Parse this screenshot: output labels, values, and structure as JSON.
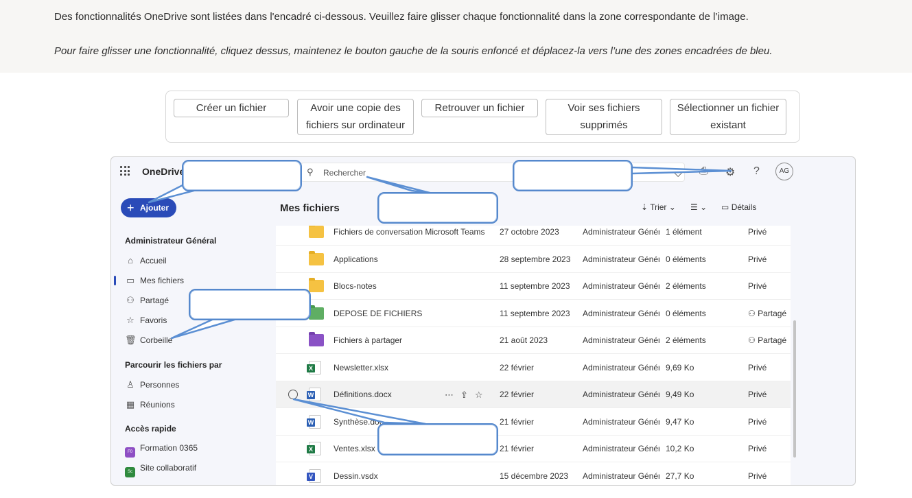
{
  "instructions": {
    "line1": "Des fonctionnalités OneDrive sont listées dans l'encadré ci-dessous. Veuillez faire glisser chaque fonctionnalité dans la zone correspondante de l’image.",
    "line2": "Pour faire glisser une fonctionnalité, cliquez dessus, maintenez le bouton gauche de la souris enfoncé et déplacez-la vers l’une des zones encadrées de bleu."
  },
  "chips": [
    {
      "line1": "Créer un fichier",
      "line2": ""
    },
    {
      "line1": "Avoir une copie des",
      "line2": "fichiers sur ordinateur"
    },
    {
      "line1": "Retrouver un fichier",
      "line2": ""
    },
    {
      "line1": "Voir ses fichiers",
      "line2": "supprimés"
    },
    {
      "line1": "Sélectionner un fichier",
      "line2": "existant"
    }
  ],
  "app": {
    "brand": "OneDrive",
    "search_placeholder": "Rechercher",
    "avatar": "AG",
    "add_label": "Ajouter",
    "page_title": "Mes fichiers",
    "sort_label": "Trier",
    "details_label": "Détails"
  },
  "sidebar": {
    "user": "Administrateur Général",
    "items": [
      "Accueil",
      "Mes fichiers",
      "Partagé",
      "Favoris",
      "Corbeille"
    ],
    "browse_title": "Parcourir les fichiers par",
    "browse_items": [
      "Personnes",
      "Réunions"
    ],
    "quick_title": "Accès rapide",
    "quick_items": [
      {
        "label": "Formation 0365",
        "badge": "F0",
        "color": "#8e4fc4"
      },
      {
        "label": "Site collaboratif",
        "badge": "Sc",
        "color": "#2f8a3e"
      }
    ]
  },
  "files": [
    {
      "name": "Fichiers de conversation Microsoft Teams",
      "date": "27 octobre 2023",
      "owner": "Administrateur Généra",
      "size": "1 élément",
      "share": "Privé",
      "type": "folder"
    },
    {
      "name": "Applications",
      "date": "28 septembre 2023",
      "owner": "Administrateur Généra",
      "size": "0 éléments",
      "share": "Privé",
      "type": "folder"
    },
    {
      "name": "Blocs-notes",
      "date": "11 septembre 2023",
      "owner": "Administrateur Généra",
      "size": "2 éléments",
      "share": "Privé",
      "type": "folder"
    },
    {
      "name": "DEPOSE DE FICHIERS",
      "date": "11 septembre 2023",
      "owner": "Administrateur Généra",
      "size": "0 éléments",
      "share": "Partagé",
      "type": "folder-green"
    },
    {
      "name": "Fichiers à partager",
      "date": "21 août 2023",
      "owner": "Administrateur Généra",
      "size": "2 éléments",
      "share": "Partagé",
      "type": "folder-purple"
    },
    {
      "name": "Newsletter.xlsx",
      "date": "22 février",
      "owner": "Administrateur Généra",
      "size": "9,69 Ko",
      "share": "Privé",
      "type": "xlsx"
    },
    {
      "name": "Définitions.docx",
      "date": "22 février",
      "owner": "Administrateur Généra",
      "size": "9,49 Ko",
      "share": "Privé",
      "type": "docx"
    },
    {
      "name": "Synthèse.docx",
      "date": "21 février",
      "owner": "Administrateur Généra",
      "size": "9,47 Ko",
      "share": "Privé",
      "type": "docx"
    },
    {
      "name": "Ventes.xlsx",
      "date": "21 février",
      "owner": "Administrateur Généra",
      "size": "10,2 Ko",
      "share": "Privé",
      "type": "xlsx"
    },
    {
      "name": "Dessin.vsdx",
      "date": "15 décembre 2023",
      "owner": "Administrateur Généra",
      "size": "27,7 Ko",
      "share": "Privé",
      "type": "vsdx"
    }
  ],
  "accent_color": "#2a4bb8",
  "dropzone_color": "#5588cc"
}
